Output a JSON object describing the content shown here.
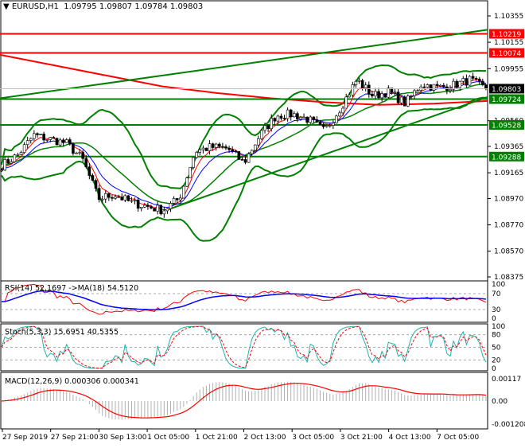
{
  "header": {
    "symbol": "EURUSD,H1",
    "open": "1.09795",
    "high": "1.09807",
    "low": "1.09784",
    "close": "1.09803"
  },
  "price_axis": {
    "ticks": [
      "1.10355",
      "1.10155",
      "1.09955",
      "1.09560",
      "1.09365",
      "1.09165",
      "1.08970",
      "1.08770",
      "1.08570",
      "1.08375"
    ],
    "ticks_values": [
      1.10355,
      1.10155,
      1.09955,
      1.0956,
      1.09365,
      1.09165,
      1.0897,
      1.0877,
      1.0857,
      1.08375
    ],
    "current": {
      "label": "1.09803",
      "value": 1.09803,
      "color": "#000000"
    },
    "levels": [
      {
        "label": "1.10219",
        "value": 1.10219,
        "color": "#ff0000"
      },
      {
        "label": "1.10074",
        "value": 1.10074,
        "color": "#ff0000"
      },
      {
        "label": "1.09724",
        "value": 1.09724,
        "color": "#008000"
      },
      {
        "label": "1.09528",
        "value": 1.09528,
        "color": "#008000"
      },
      {
        "label": "1.09288",
        "value": 1.09288,
        "color": "#008000"
      }
    ]
  },
  "rsi": {
    "label": "RSI(14) 52.1697  ->MA(18) 54.5120",
    "ticks": [
      "100",
      "70",
      "30",
      "0"
    ]
  },
  "stoch": {
    "label": "Stoch(5,3,3) 15.6951 40.5355",
    "ticks": [
      "100",
      "80",
      "50",
      "20",
      "0"
    ]
  },
  "macd": {
    "label": "MACD(12,26,9) 0.000306 0.000341",
    "ticks": [
      "0.00117",
      "0.00",
      "-0.001208"
    ]
  },
  "time_axis": [
    "27 Sep 2019",
    "27 Sep 21:00",
    "30 Sep 13:00",
    "1 Oct 05:00",
    "1 Oct 21:00",
    "2 Oct 13:00",
    "3 Oct 05:00",
    "3 Oct 21:00",
    "4 Oct 13:00",
    "7 Oct 05:00"
  ],
  "chart_data": {
    "type": "candlestick",
    "anchors_close": [
      1.0922,
      1.093,
      1.0945,
      1.0942,
      1.0939,
      1.0927,
      1.0897,
      1.09,
      1.0894,
      1.0891,
      1.0888,
      1.0897,
      1.0933,
      1.0936,
      1.0935,
      1.0924,
      1.0945,
      1.096,
      1.0961,
      1.0957,
      1.0948,
      1.0966,
      1.0987,
      1.0975,
      1.0978,
      1.0969,
      1.0984,
      1.0981,
      1.0983,
      1.0987,
      1.098
    ],
    "ma_long": [
      1.1006,
      1.0998,
      1.099,
      1.0982,
      1.0977,
      1.0973,
      1.097,
      1.0968,
      1.0969,
      1.0971
    ],
    "trendlines": [
      {
        "from": 1.0973,
        "to": 1.1025,
        "start": 0,
        "end": 1,
        "color": "#008000"
      },
      {
        "from": 1.0888,
        "to": 1.0974,
        "start": 0.34,
        "end": 1,
        "color": "#008000"
      }
    ],
    "colors": {
      "up": "#008000",
      "down": "#000000",
      "bands": "#008000",
      "ma_long": "#ff0000"
    }
  }
}
